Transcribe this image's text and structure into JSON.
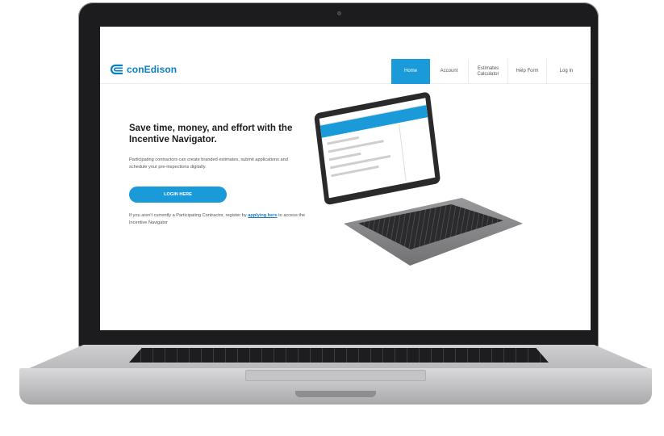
{
  "brand": {
    "name": "conEdison",
    "color": "#0a7ec2"
  },
  "nav": {
    "items": [
      {
        "label": "Home",
        "active": true
      },
      {
        "label": "Account",
        "active": false
      },
      {
        "label": "Estimates Calculator",
        "active": false
      },
      {
        "label": "Help Form",
        "active": false
      },
      {
        "label": "Log In",
        "active": false
      }
    ],
    "accent": "#1a9ad8"
  },
  "hero": {
    "title": "Save time, money, and effort with the Incentive Navigator.",
    "description": "Participating contractors can create branded estimates, submit applications and schedule your pre-inspections digitally.",
    "login_label": "LOGIN HERE",
    "register_prefix": "If you aren't currently a Participating Contractor, register by ",
    "register_link": "applying here",
    "register_suffix": " to access the Incentive Navigator"
  },
  "icons": {
    "logo": "conedison-logo-icon",
    "illustration": "laptop-illustration"
  }
}
